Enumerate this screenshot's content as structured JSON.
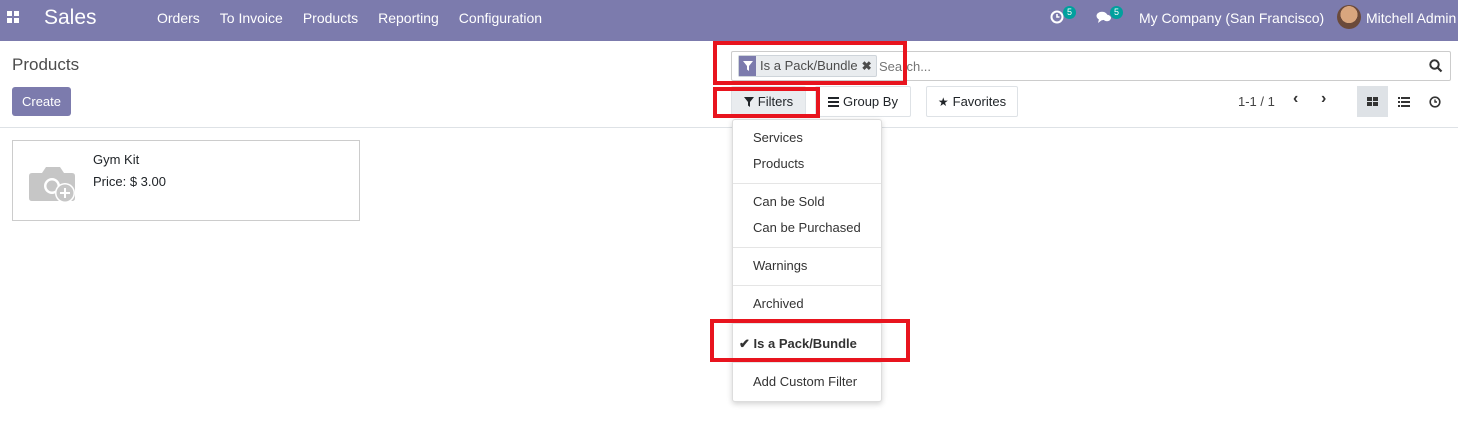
{
  "navbar": {
    "brand": "Sales",
    "menu": [
      "Orders",
      "To Invoice",
      "Products",
      "Reporting",
      "Configuration"
    ],
    "activity_count": "5",
    "messages_count": "5",
    "company": "My Company (San Francisco)",
    "user": "Mitchell Admin"
  },
  "control_panel": {
    "title": "Products",
    "create_label": "Create",
    "facet_label": "Is a Pack/Bundle",
    "search_placeholder": "Search...",
    "filters_label": "Filters",
    "groupby_label": "Group By",
    "favorites_label": "Favorites",
    "pager": "1-1 / 1"
  },
  "products": [
    {
      "name": "Gym Kit",
      "price": "Price: $ 3.00"
    }
  ],
  "filters_menu": {
    "services": "Services",
    "products": "Products",
    "can_be_sold": "Can be Sold",
    "can_be_purchased": "Can be Purchased",
    "warnings": "Warnings",
    "archived": "Archived",
    "pack_bundle": "Is a Pack/Bundle",
    "add_custom": "Add Custom Filter"
  },
  "colors": {
    "brand": "#7c7bad",
    "highlight": "#e8141e",
    "badge": "#00a09d"
  }
}
